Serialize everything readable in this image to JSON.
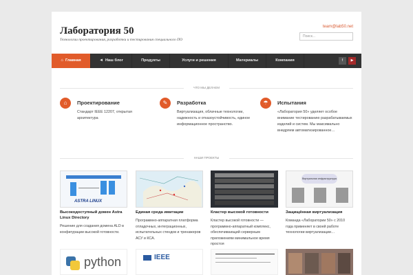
{
  "header": {
    "site_title": "Лаборатория 50",
    "tagline": "Технологии проектирования, разработки и тестирования специального ПО",
    "email": "team@lab50.net",
    "search_placeholder": "Поиск..."
  },
  "nav": {
    "items": [
      {
        "label": "Главная",
        "active": true,
        "icon": "home-icon"
      },
      {
        "label": "Наш блог",
        "icon": "megaphone-icon"
      },
      {
        "label": "Продукты"
      },
      {
        "label": "Услуги и решения"
      },
      {
        "label": "Материалы"
      },
      {
        "label": "Компания"
      }
    ],
    "social": [
      {
        "icon": "facebook-icon",
        "glyph": "f"
      },
      {
        "icon": "youtube-icon",
        "glyph": "▶"
      }
    ]
  },
  "what_we_do": {
    "heading": "Что мы делаем",
    "features": [
      {
        "title": "Проектирование",
        "text": "Стандарт IEEE 12207, открытая архитектура",
        "icon": "cubes-icon",
        "glyph": "⌂"
      },
      {
        "title": "Разработка",
        "text": "Виртуализация, облачные технологии, надежность и отказоустойчивость, единое информационное пространство.",
        "icon": "wrench-icon",
        "glyph": "✎"
      },
      {
        "title": "Испытания",
        "text": "«Лаборатория 50» уделяет особое внимание тестированию разрабатываемых изделий и систем. Мы максимально внедряем автоматизированное…",
        "icon": "umbrella-icon",
        "glyph": "☂"
      }
    ]
  },
  "projects": {
    "heading": "Наши проекты",
    "items": [
      {
        "title": "Высокодоступный домен Astra Linux Directory",
        "text": "Решение для создания домена ALD в конфигурации высокой готовности.",
        "thumb_label": "ASTRA LINUX"
      },
      {
        "title": "Единая среда имитации",
        "text": "Программно-аппаратная платформа отладочных, интеграционных, испытательных стендов и тренажеров АСУ и КСА."
      },
      {
        "title": "Кластер высокой готовности",
        "text": "Кластер высокой готовности — программно-аппаратный комплекс, обеспечивающий серверным приложениям минимальное время простоя"
      },
      {
        "title": "Защищённая виртуализация",
        "text": "Команда «Лаборатории 50» с 2010 года применяет в своей работе технологии виртуализации…",
        "thumb_label": "Виртуальная инфраструктура"
      }
    ],
    "more_thumbs": [
      {
        "label": "python"
      },
      {
        "label": "IEEE"
      },
      {
        "label": ""
      },
      {
        "label": ""
      }
    ]
  },
  "colors": {
    "accent": "#e15b2a",
    "nav_bg": "#333333",
    "page_bg": "#eaeaea"
  }
}
